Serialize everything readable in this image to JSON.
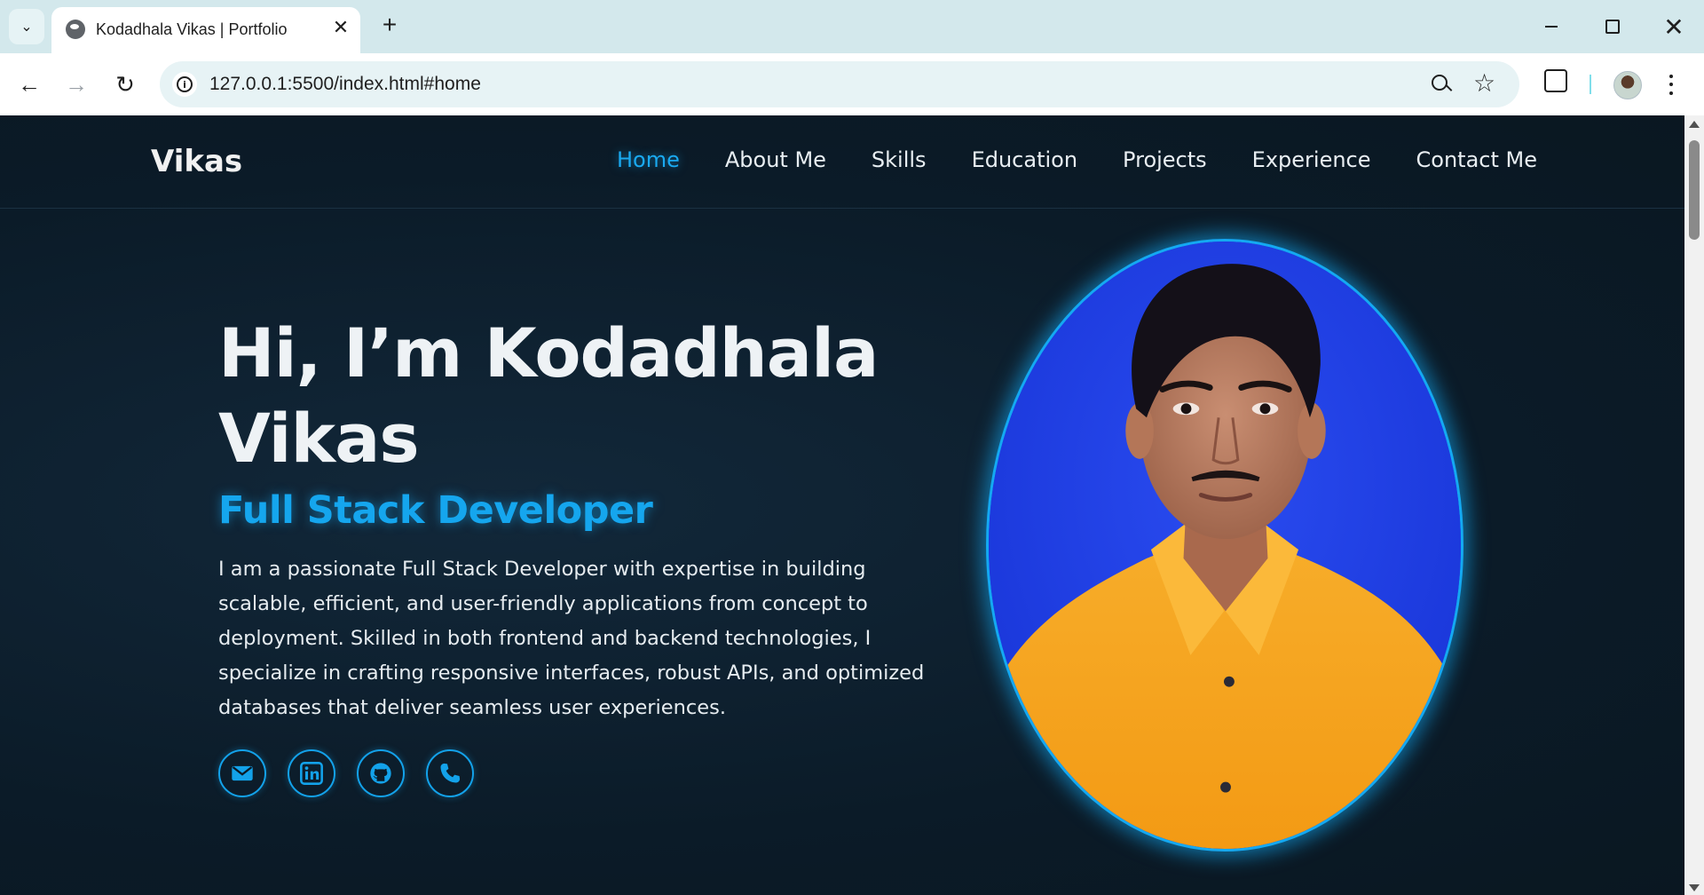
{
  "browser": {
    "tab_title": "Kodadhala Vikas | Portfolio",
    "url": "127.0.0.1:5500/index.html#home",
    "icons": [
      "tab-search-icon",
      "globe-icon",
      "close-icon",
      "plus-icon",
      "minimize-icon",
      "restore-icon",
      "close-window-icon",
      "back-icon",
      "forward-icon",
      "reload-icon",
      "info-icon",
      "zoom-icon",
      "star-icon",
      "extensions-icon",
      "avatar",
      "more-icon"
    ]
  },
  "site": {
    "logo": "Vikas",
    "nav": [
      {
        "label": "Home",
        "active": true
      },
      {
        "label": "About Me"
      },
      {
        "label": "Skills"
      },
      {
        "label": "Education"
      },
      {
        "label": "Projects"
      },
      {
        "label": "Experience"
      },
      {
        "label": "Contact Me"
      }
    ]
  },
  "hero": {
    "title": "Hi, I’m Kodadhala Vikas",
    "role": "Full Stack Developer",
    "description": "I am a passionate Full Stack Developer with expertise in building scalable, efficient, and user-friendly applications from concept to deployment. Skilled in both frontend and backend technologies, I specialize in crafting responsive interfaces, robust APIs, and optimized databases that deliver seamless user experiences.",
    "socials": [
      "email-icon",
      "linkedin-icon",
      "github-icon",
      "phone-icon"
    ]
  },
  "colors": {
    "accent": "#15a6ee",
    "background": "#0b1a26",
    "chrome": "#d3e8ec"
  }
}
